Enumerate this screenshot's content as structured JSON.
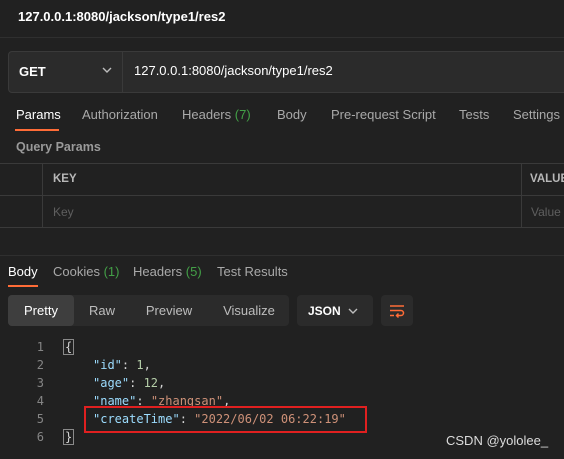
{
  "window": {
    "title": "127.0.0.1:8080/jackson/type1/res2"
  },
  "request": {
    "method": "GET",
    "url": "127.0.0.1:8080/jackson/type1/res2"
  },
  "request_tabs": [
    {
      "label": "Params"
    },
    {
      "label": "Authorization"
    },
    {
      "label": "Headers",
      "count": "(7)"
    },
    {
      "label": "Body"
    },
    {
      "label": "Pre-request Script"
    },
    {
      "label": "Tests"
    },
    {
      "label": "Settings"
    }
  ],
  "query_params": {
    "title": "Query Params",
    "columns": [
      "KEY",
      "VALUE"
    ],
    "key_placeholder": "Key",
    "value_placeholder": "Value"
  },
  "response_tabs": [
    {
      "label": "Body"
    },
    {
      "label": "Cookies",
      "count": "(1)"
    },
    {
      "label": "Headers",
      "count": "(5)"
    },
    {
      "label": "Test Results"
    }
  ],
  "view_modes": [
    "Pretty",
    "Raw",
    "Preview",
    "Visualize"
  ],
  "format": "JSON",
  "code": {
    "line_numbers": [
      "1",
      "2",
      "3",
      "4",
      "5",
      "6"
    ],
    "open_brace": "{",
    "close_brace": "}",
    "fields": [
      {
        "key": "\"id\"",
        "value": "1",
        "sep": ",",
        "type": "number"
      },
      {
        "key": "\"age\"",
        "value": "12",
        "sep": ",",
        "type": "number"
      },
      {
        "key": "\"name\"",
        "value": "\"zhangsan\"",
        "sep": ",",
        "type": "string"
      },
      {
        "key": "\"createTime\"",
        "value": "\"2022/06/02 06:22:19\"",
        "sep": "",
        "type": "string"
      }
    ]
  },
  "watermark": "CSDN @yololee_",
  "colors": {
    "accent": "#ff6c37",
    "count_green": "#43a047",
    "annotation_red": "#e02020",
    "background": "#212121"
  }
}
